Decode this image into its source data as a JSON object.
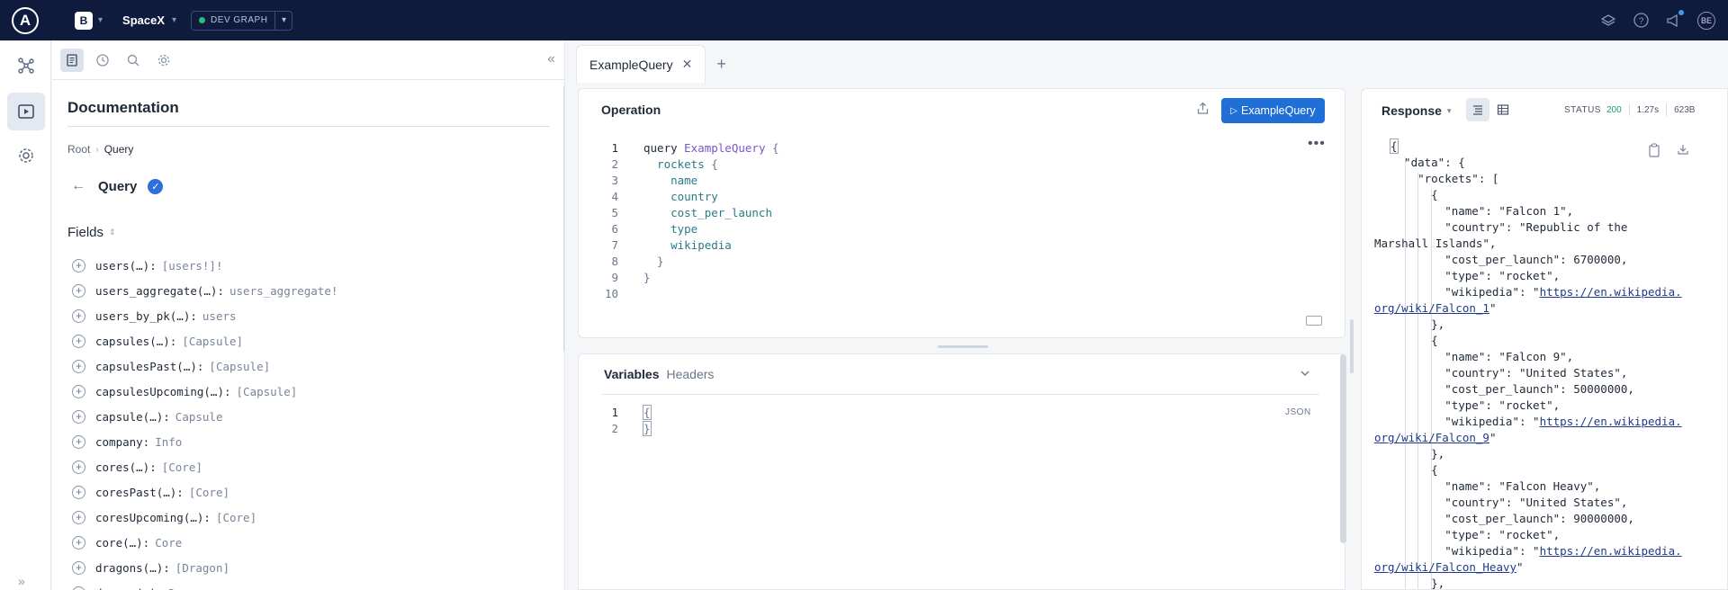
{
  "topbar": {
    "org_initial": "B",
    "graph_name": "SpaceX",
    "variant_label": "DEV GRAPH",
    "avatar_initials": "BE"
  },
  "docs": {
    "title": "Documentation",
    "breadcrumb_root": "Root",
    "breadcrumb_current": "Query",
    "type_name": "Query",
    "fields_heading": "Fields",
    "fields": [
      {
        "name": "users(…):",
        "type": "[users!]!"
      },
      {
        "name": "users_aggregate(…):",
        "type": "users_aggregate!"
      },
      {
        "name": "users_by_pk(…):",
        "type": "users"
      },
      {
        "name": "capsules(…):",
        "type": "[Capsule]"
      },
      {
        "name": "capsulesPast(…):",
        "type": "[Capsule]"
      },
      {
        "name": "capsulesUpcoming(…):",
        "type": "[Capsule]"
      },
      {
        "name": "capsule(…):",
        "type": "Capsule"
      },
      {
        "name": "company:",
        "type": "Info"
      },
      {
        "name": "cores(…):",
        "type": "[Core]"
      },
      {
        "name": "coresPast(…):",
        "type": "[Core]"
      },
      {
        "name": "coresUpcoming(…):",
        "type": "[Core]"
      },
      {
        "name": "core(…):",
        "type": "Core"
      },
      {
        "name": "dragons(…):",
        "type": "[Dragon]"
      },
      {
        "name": "dragon(…):",
        "type": "Dragon"
      }
    ]
  },
  "tabs": [
    {
      "label": "ExampleQuery"
    }
  ],
  "operation": {
    "title": "Operation",
    "run_label": "ExampleQuery",
    "lines": [
      {
        "n": "1",
        "parts": [
          {
            "t": "query ",
            "c": "kw"
          },
          {
            "t": "ExampleQuery",
            "c": "opname"
          },
          {
            "t": " {",
            "c": "punct"
          }
        ]
      },
      {
        "n": "2",
        "parts": [
          {
            "t": "  rockets",
            "c": "fld"
          },
          {
            "t": " {",
            "c": "punct"
          }
        ]
      },
      {
        "n": "3",
        "parts": [
          {
            "t": "    name",
            "c": "fld"
          }
        ]
      },
      {
        "n": "4",
        "parts": [
          {
            "t": "    country",
            "c": "fld"
          }
        ]
      },
      {
        "n": "5",
        "parts": [
          {
            "t": "    cost_per_launch",
            "c": "fld"
          }
        ]
      },
      {
        "n": "6",
        "parts": [
          {
            "t": "    type",
            "c": "fld"
          }
        ]
      },
      {
        "n": "7",
        "parts": [
          {
            "t": "    wikipedia",
            "c": "fld"
          }
        ]
      },
      {
        "n": "8",
        "parts": [
          {
            "t": "  }",
            "c": "punct"
          }
        ]
      },
      {
        "n": "9",
        "parts": [
          {
            "t": "}",
            "c": "punct"
          }
        ]
      },
      {
        "n": "10",
        "parts": []
      }
    ]
  },
  "variables": {
    "tab_active": "Variables",
    "tab_inactive": "Headers",
    "format_label": "JSON",
    "lines": [
      {
        "n": "1",
        "text": "{"
      },
      {
        "n": "2",
        "text": "}"
      }
    ]
  },
  "response": {
    "title": "Response",
    "status_label": "STATUS",
    "status_code": "200",
    "time": "1.27s",
    "size": "623B",
    "lines": [
      {
        "text": "{"
      },
      {
        "text": "  \"data\": {"
      },
      {
        "text": "    \"rockets\": ["
      },
      {
        "text": "      {"
      },
      {
        "text": "        \"name\": \"Falcon 1\","
      },
      {
        "text": "        \"country\": \"Republic of the"
      },
      {
        "text": "Marshall Islands\","
      },
      {
        "text": "        \"cost_per_launch\": 6700000,"
      },
      {
        "text": "        \"type\": \"rocket\","
      },
      {
        "text": "        \"wikipedia\": \"",
        "link": "https://en.wikipedia."
      },
      {
        "text": "",
        "link": "org/wiki/Falcon_1",
        "after": "\""
      },
      {
        "text": "      },"
      },
      {
        "text": "      {"
      },
      {
        "text": "        \"name\": \"Falcon 9\","
      },
      {
        "text": "        \"country\": \"United States\","
      },
      {
        "text": "        \"cost_per_launch\": 50000000,"
      },
      {
        "text": "        \"type\": \"rocket\","
      },
      {
        "text": "        \"wikipedia\": \"",
        "link": "https://en.wikipedia."
      },
      {
        "text": "",
        "link": "org/wiki/Falcon_9",
        "after": "\""
      },
      {
        "text": "      },"
      },
      {
        "text": "      {"
      },
      {
        "text": "        \"name\": \"Falcon Heavy\","
      },
      {
        "text": "        \"country\": \"United States\","
      },
      {
        "text": "        \"cost_per_launch\": 90000000,"
      },
      {
        "text": "        \"type\": \"rocket\","
      },
      {
        "text": "        \"wikipedia\": \"",
        "link": "https://en.wikipedia."
      },
      {
        "text": "",
        "link": "org/wiki/Falcon_Heavy",
        "after": "\""
      },
      {
        "text": "      },"
      }
    ]
  }
}
